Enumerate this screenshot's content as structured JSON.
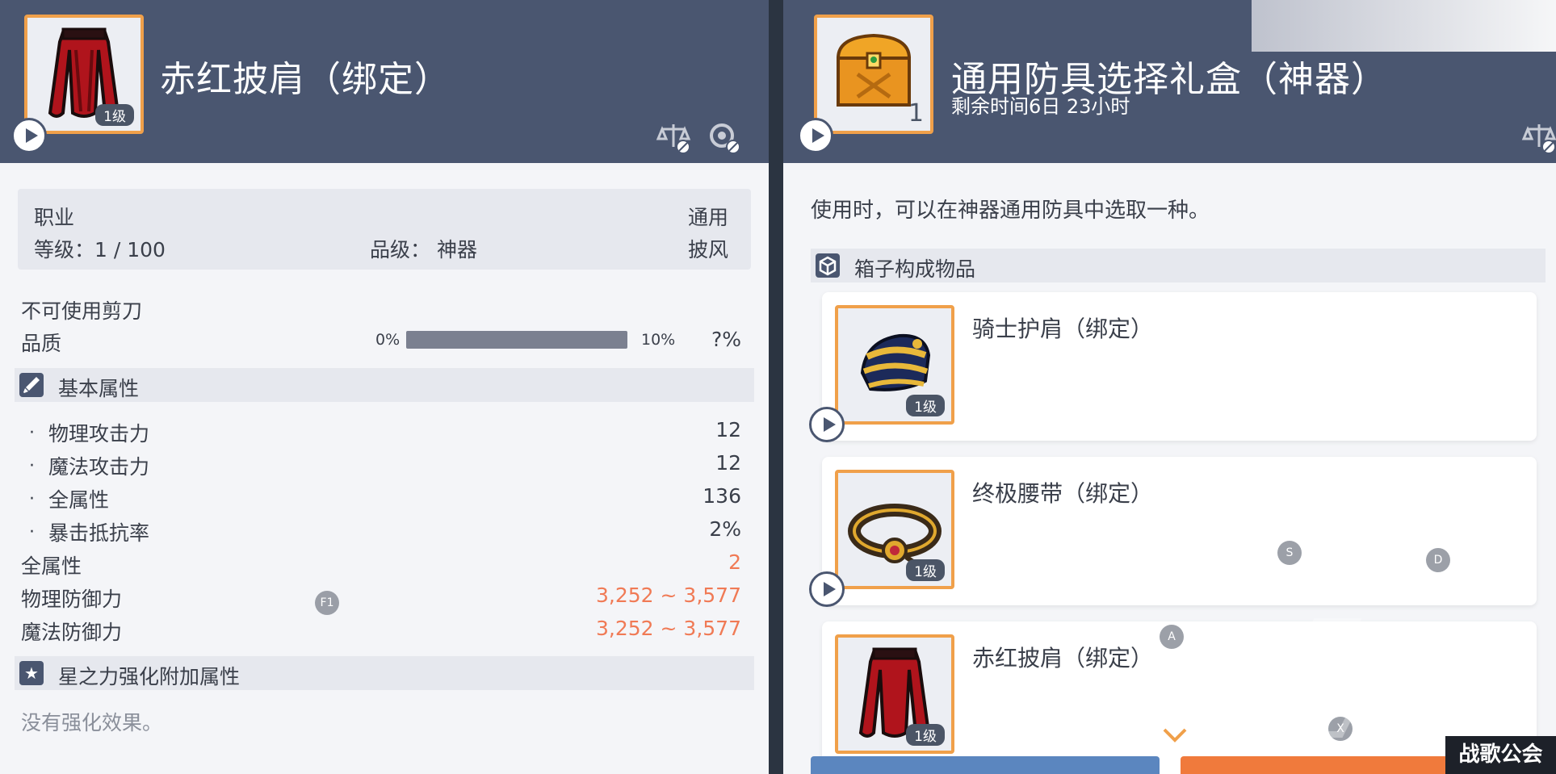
{
  "left_panel": {
    "item_name": "赤红披肩（绑定）",
    "level_tag": "1级",
    "info": {
      "job_label": "职业",
      "job_value": "通用",
      "level_text": "等级：1 / 100",
      "grade_text": "品级： 神器",
      "type_value": "披风"
    },
    "scissors_text": "不可使用剪刀",
    "quality": {
      "label": "品质",
      "min_label": "0%",
      "max_label": "10%",
      "value": "?%"
    },
    "basic_section": {
      "title": "基本属性",
      "icon": "sword-icon"
    },
    "basic_stats": [
      {
        "label": "物理攻击力",
        "value": "12"
      },
      {
        "label": "魔法攻击力",
        "value": "12"
      },
      {
        "label": "全属性",
        "value": "136"
      },
      {
        "label": "暴击抵抗率",
        "value": "2%"
      }
    ],
    "extra_stats": [
      {
        "label": "全属性",
        "value": "2"
      },
      {
        "label": "物理防御力",
        "value": "3,252 ~ 3,577"
      },
      {
        "label": "魔法防御力",
        "value": "3,252 ~ 3,577"
      }
    ],
    "star_section": {
      "title": "星之力强化附加属性",
      "icon": "star-icon"
    },
    "no_enhance_text": "没有强化效果。",
    "bullet": "·",
    "f1_key": "F1"
  },
  "right_panel": {
    "item_name": "通用防具选择礼盒（神器）",
    "remaining_time": "剩余时间6日 23小时",
    "count": "1",
    "description": "使用时，可以在神器通用防具中选取一种。",
    "contents_section": {
      "title": "箱子构成物品",
      "icon": "box-icon"
    },
    "contents": [
      {
        "name": "骑士护肩（绑定）",
        "level_tag": "1级",
        "icon": "shoulder-armor-icon"
      },
      {
        "name": "终极腰带（绑定）",
        "level_tag": "1级",
        "icon": "belt-icon"
      },
      {
        "name": "赤红披肩（绑定）",
        "level_tag": "1级",
        "icon": "red-cape-icon"
      }
    ],
    "keys": [
      "S",
      "D",
      "A",
      "X"
    ]
  },
  "watermark": {
    "text": "战歌公会"
  },
  "colors": {
    "header": "#4a5670",
    "accent_orange": "#f0a04a",
    "stat_orange": "#f07a55",
    "panel_bg": "#f4f5f8"
  }
}
